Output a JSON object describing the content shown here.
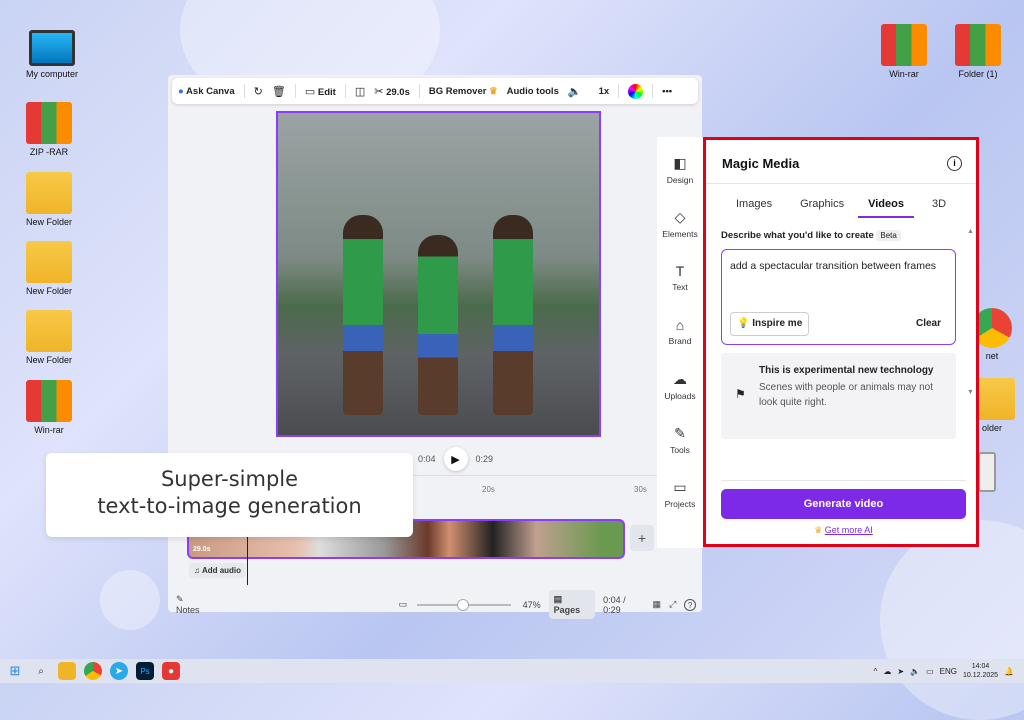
{
  "desktop": {
    "left_icons": [
      "My computer",
      "ZIP -RAR",
      "New Folder",
      "New Folder",
      "New Folder",
      "Win-rar"
    ],
    "right_icons": [
      "Win-rar",
      "Folder (1)"
    ],
    "partial_icons": [
      "net",
      "older"
    ]
  },
  "toolbar": {
    "ask": "Ask Canva",
    "edit": "Edit",
    "duration": "29.0s",
    "bg": "BG Remover",
    "audio": "Audio tools",
    "speed": "1x"
  },
  "playback": {
    "current": "0:04",
    "total": "0:29"
  },
  "ruler": [
    "20s",
    "30s"
  ],
  "filmstrip": {
    "clip_duration": "29.0s",
    "add_audio": "Add audio"
  },
  "bottom": {
    "notes": "Notes",
    "zoom": "47%",
    "zoom_fraction": 0.47,
    "pages": "Pages",
    "time": "0:04 / 0:29"
  },
  "rail": [
    "Design",
    "Elements",
    "Text",
    "Brand",
    "Uploads",
    "Tools",
    "Projects"
  ],
  "panel": {
    "title": "Magic Media",
    "tabs": [
      "Images",
      "Graphics",
      "Videos",
      "3D"
    ],
    "active_tab": "Videos",
    "prompt_label": "Describe what you'd like to create",
    "beta": "Beta",
    "prompt": "add a spectacular transition between frames",
    "inspire": "Inspire me",
    "clear": "Clear",
    "notice_title": "This is experimental new technology",
    "notice_body": "Scenes with people or animals may not look quite right.",
    "generate": "Generate video",
    "get_more": "Get more AI"
  },
  "callout": {
    "line1": "Super-simple",
    "line2": "text-to-image generation"
  },
  "taskbar": {
    "lang": "ENG",
    "time": "14:04",
    "date": "10.12.2025"
  },
  "colors": {
    "accent": "#7d2ae8",
    "highlight": "#e0001a"
  }
}
